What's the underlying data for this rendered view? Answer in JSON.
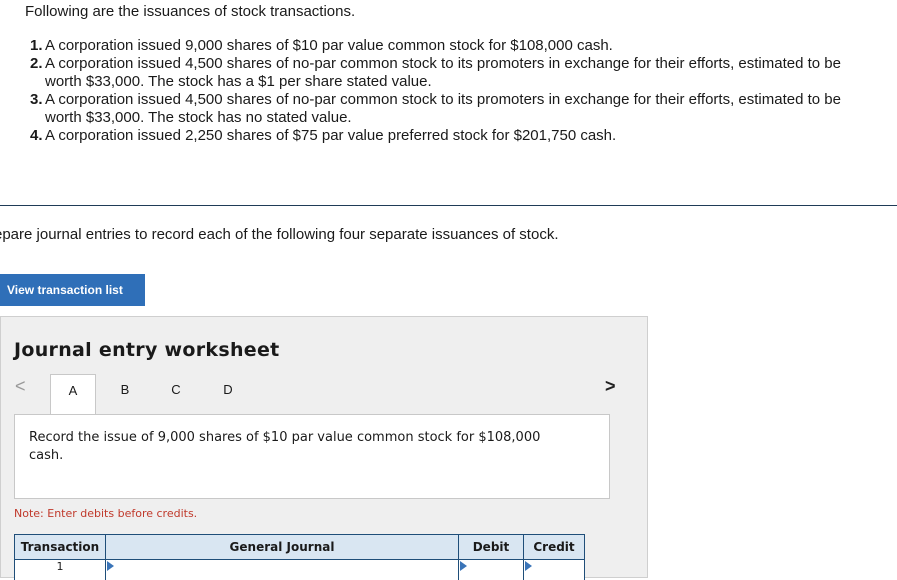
{
  "intro": "Following are the issuances of stock transactions.",
  "transactions": [
    {
      "num": "1.",
      "text": "A corporation issued 9,000 shares of $10 par value common stock for $108,000 cash."
    },
    {
      "num": "2.",
      "text": "A corporation issued 4,500 shares of no-par common stock to its promoters in exchange for their efforts, estimated to be worth $33,000. The stock has a $1 per share stated value."
    },
    {
      "num": "3.",
      "text": "A corporation issued 4,500 shares of no-par common stock to its promoters in exchange for their efforts, estimated to be worth $33,000. The stock has no stated value."
    },
    {
      "num": "4.",
      "text": "A corporation issued 2,250 shares of $75 par value preferred stock for $201,750 cash."
    }
  ],
  "prepare_text": "epare journal entries to record each of the following four separate issuances of stock.",
  "view_button": "View transaction list",
  "worksheet": {
    "title": "Journal entry worksheet",
    "nav_prev": "<",
    "nav_next": ">",
    "tabs": [
      "A",
      "B",
      "C",
      "D"
    ],
    "active_tab": "A",
    "description": "Record the issue of 9,000 shares of $10 par value common stock for $108,000 cash.",
    "note": "Note: Enter debits before credits.",
    "table": {
      "headers": {
        "transaction": "Transaction",
        "general_journal": "General Journal",
        "debit": "Debit",
        "credit": "Credit"
      },
      "rows": [
        {
          "transaction": "1"
        }
      ]
    }
  },
  "colors": {
    "accent": "#2f6fb8",
    "table_header_bg": "#d9e6f2",
    "note": "#c0392b"
  }
}
